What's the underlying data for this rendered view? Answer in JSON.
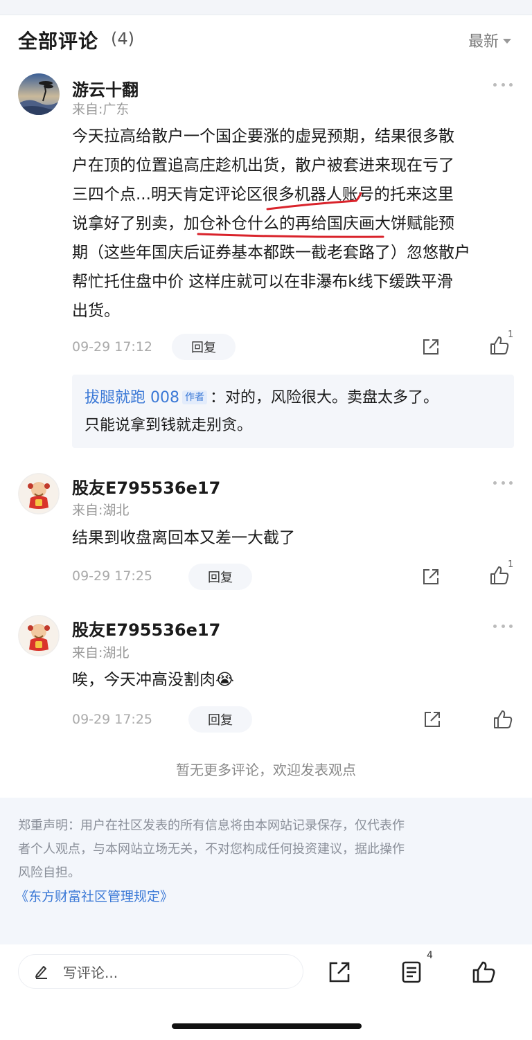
{
  "header": {
    "title": "全部评论",
    "count": "(4)",
    "sort_label": "最新"
  },
  "comments": [
    {
      "username": "游云十翻",
      "location": "来自:广东",
      "lines": [
        "今天拉高给散户一个国企要涨的虚晃预期，结果很多散",
        "户在顶的位置追高庄趁机出货，散户被套进来现在亏了",
        "三四个点...明天肯定评论区很多机器人账号的托来这里",
        "说拿好了别卖，加仓补仓什么的再给国庆画大饼赋能预",
        "期（这些年国庆后证券基本都跌一截老套路了）忽悠散户",
        "帮忙托住盘中价 这样庄就可以在非瀑布k线下缓跌平滑",
        "出货。"
      ],
      "time": "09-29 17:12",
      "reply_label": "回复",
      "like_count": "1",
      "author_reply": {
        "author": "拔腿就跑 008",
        "tag": "作者",
        "line1": "：对的，风险很大。卖盘太多了。",
        "line2": "只能说拿到钱就走别贪。"
      }
    },
    {
      "username": "股友E795536e17",
      "location": "来自:湖北",
      "text": "结果到收盘离回本又差一大截了",
      "time": "09-29 17:25",
      "reply_label": "回复",
      "like_count": "1"
    },
    {
      "username": "股友E795536e17",
      "location": "来自:湖北",
      "text": "唉，今天冲高没割肉😭",
      "time": "09-29 17:25",
      "reply_label": "回复",
      "like_count": ""
    }
  ],
  "no_more_text": "暂无更多评论，欢迎发表观点",
  "disclaimer": {
    "line1": "郑重声明：用户在社区发表的所有信息将由本网站记录保存，仅代表作",
    "line2": "者个人观点，与本网站立场无关，不对您构成任何投资建议，据此操作",
    "line3": "风险自担。",
    "link": "《东方财富社区管理规定》"
  },
  "bottom_bar": {
    "write_placeholder": "写评论...",
    "comment_count": "4"
  },
  "colors": {
    "accent": "#3a78d6",
    "annotation_red": "#d9232b"
  }
}
